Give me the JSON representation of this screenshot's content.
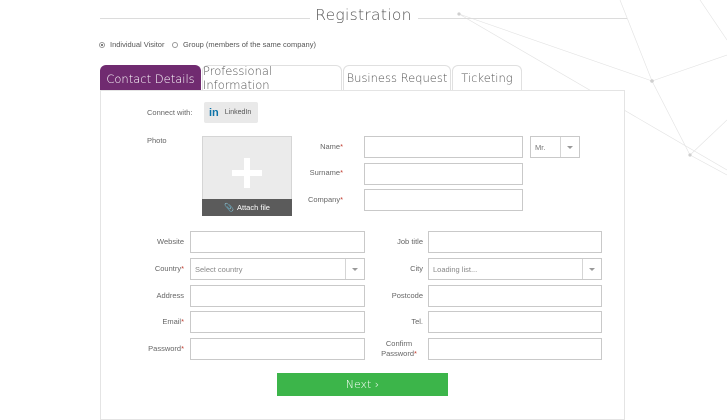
{
  "header": {
    "title": "Registration"
  },
  "visitor_type": {
    "options": [
      {
        "label": "Individual Visitor",
        "selected": true
      },
      {
        "label": "Group (members of the same company)",
        "selected": false
      }
    ]
  },
  "tabs": [
    {
      "label": "Contact Details",
      "active": true
    },
    {
      "label": "Professional Information",
      "active": false
    },
    {
      "label": "Business Request",
      "active": false
    },
    {
      "label": "Ticketing",
      "active": false
    }
  ],
  "connect": {
    "label": "Connect with:",
    "linkedin_logo": "in",
    "linkedin_label": "LinkedIn"
  },
  "photo": {
    "label": "Photo",
    "attach_label": "Attach file",
    "icons": [
      "plus-icon",
      "paperclip-icon"
    ]
  },
  "fields": {
    "name": {
      "label": "Name",
      "required": "*",
      "value": ""
    },
    "title_select": {
      "value": "Mr."
    },
    "surname": {
      "label": "Surname",
      "required": "*",
      "value": ""
    },
    "company": {
      "label": "Company",
      "required": "*",
      "value": ""
    },
    "website": {
      "label": "Website",
      "value": ""
    },
    "job_title": {
      "label": "Job title",
      "value": ""
    },
    "country": {
      "label": "Country",
      "required": "*",
      "placeholder": "Select country"
    },
    "city": {
      "label": "City",
      "placeholder": "Loading list..."
    },
    "address": {
      "label": "Address",
      "value": ""
    },
    "postcode": {
      "label": "Postcode",
      "value": ""
    },
    "email": {
      "label": "Email",
      "required": "*",
      "value": ""
    },
    "tel": {
      "label": "Tel.",
      "value": ""
    },
    "password": {
      "label": "Password",
      "required": "*",
      "value": ""
    },
    "confirm_password": {
      "label_line1": "Confirm",
      "label_line2": "Password",
      "required": "*",
      "value": ""
    }
  },
  "next_button": {
    "label": "Next ›"
  },
  "colors": {
    "accent": "#702b70",
    "primary_button": "#3cb54a",
    "required": "#c0392b"
  }
}
